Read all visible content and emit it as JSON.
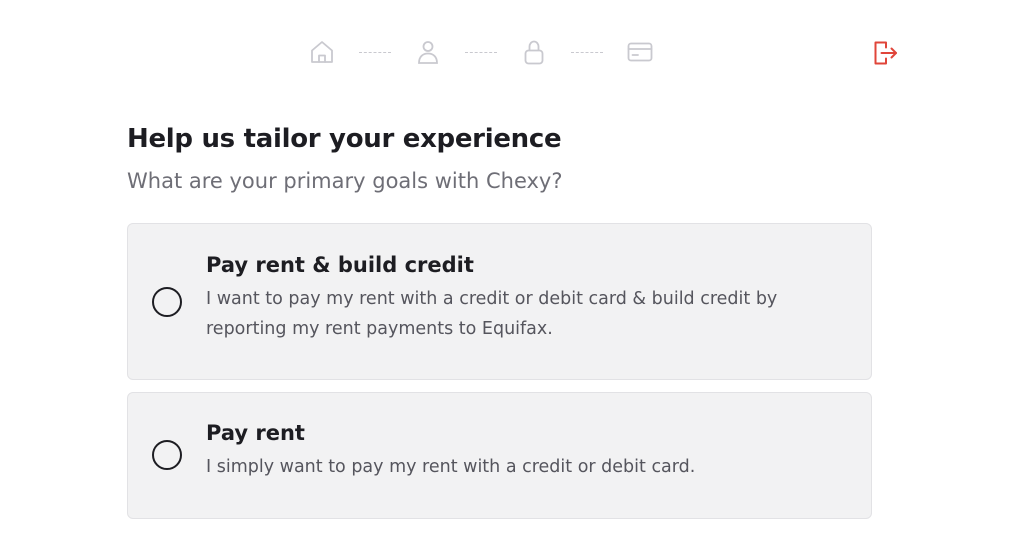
{
  "stepper": {
    "steps": [
      {
        "icon": "home-icon"
      },
      {
        "icon": "user-icon"
      },
      {
        "icon": "lock-icon"
      },
      {
        "icon": "credit-card-icon"
      }
    ],
    "inactive_color": "#c9c9cf"
  },
  "header": {
    "logout_icon": "logout-icon",
    "logout_color": "#e0453a"
  },
  "page": {
    "title": "Help us tailor your experience",
    "subtitle": "What are your primary goals with Chexy?"
  },
  "options": [
    {
      "title": "Pay rent & build credit",
      "description": "I want to pay my rent with a credit or debit card & build credit by reporting my rent payments to Equifax.",
      "selected": false
    },
    {
      "title": "Pay rent",
      "description": "I simply want to pay my rent with a credit or debit card.",
      "selected": false
    }
  ]
}
